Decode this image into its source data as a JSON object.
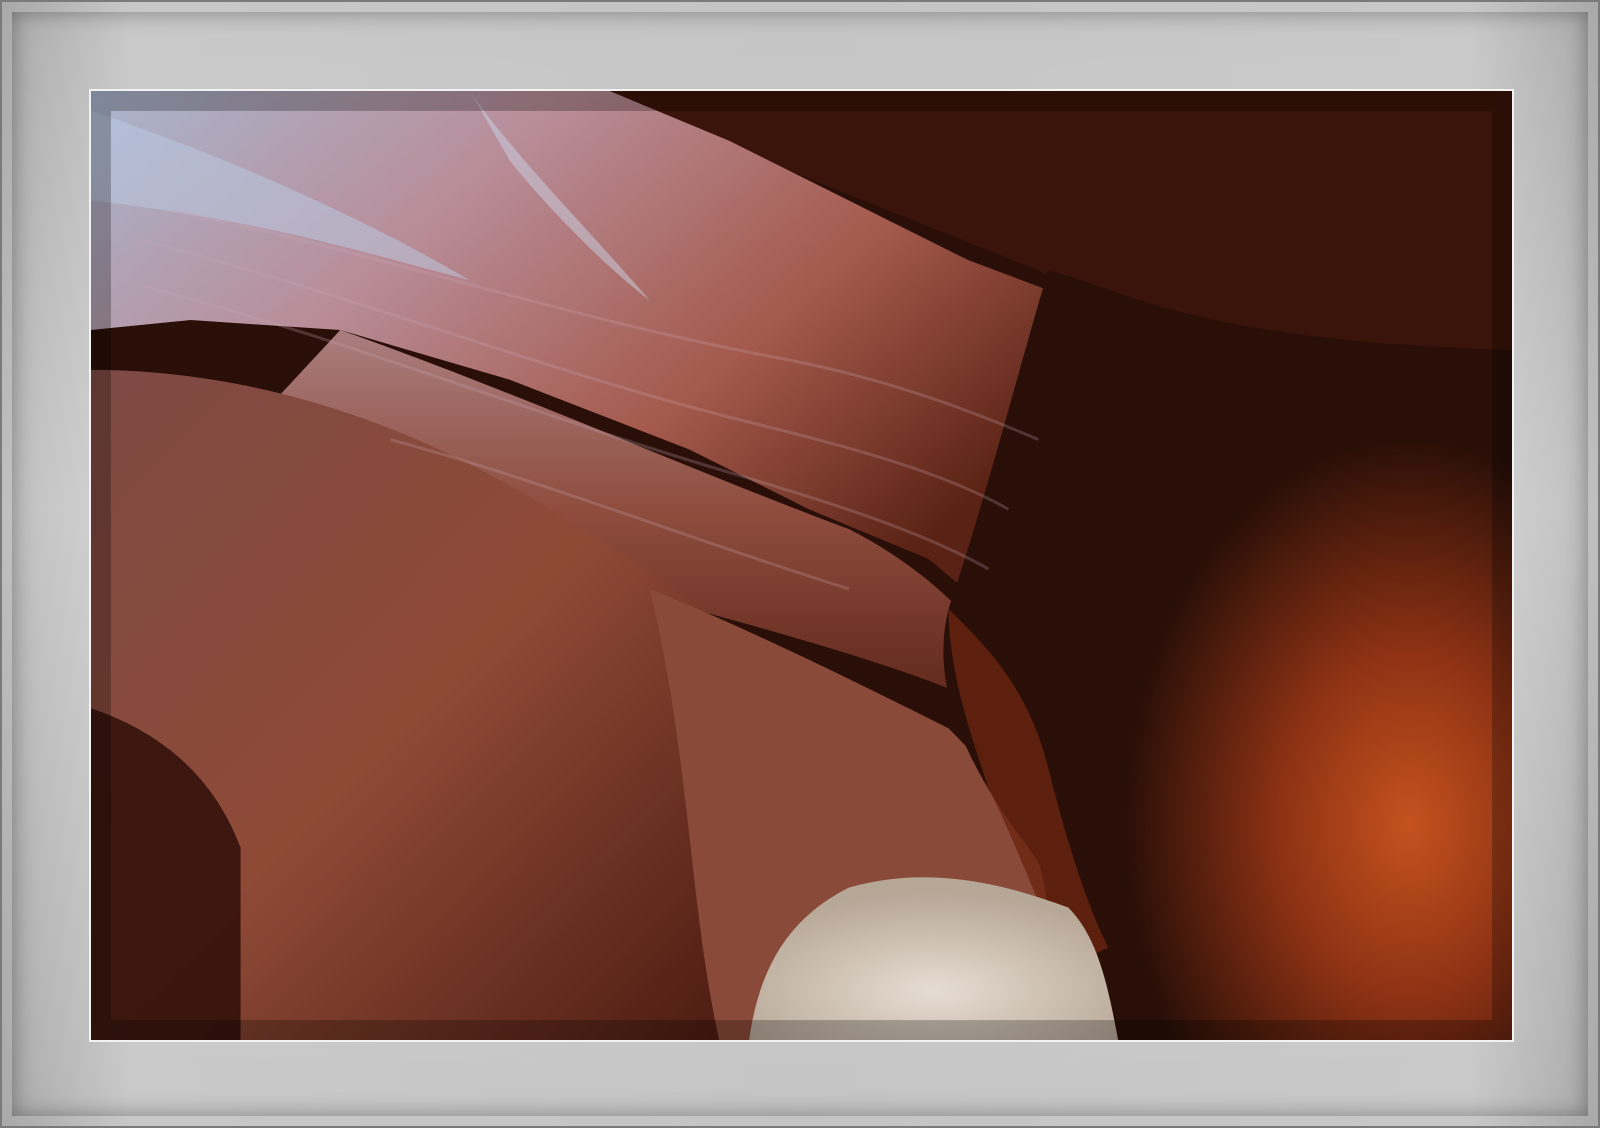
{
  "image": {
    "subject": "slot-canyon-photograph",
    "colors": {
      "mat": "#c4c4c4",
      "mat_edge": "#8c8c8c",
      "inner_border": "#f2f2f2",
      "rock_dark": "#2a0f08",
      "rock_red": "#8a3a22",
      "rock_orange": "#c4521e",
      "rock_highlight": "#c9a9b8",
      "sky_blue": "#b9c9e0",
      "sand": "#d9cfc3"
    }
  }
}
